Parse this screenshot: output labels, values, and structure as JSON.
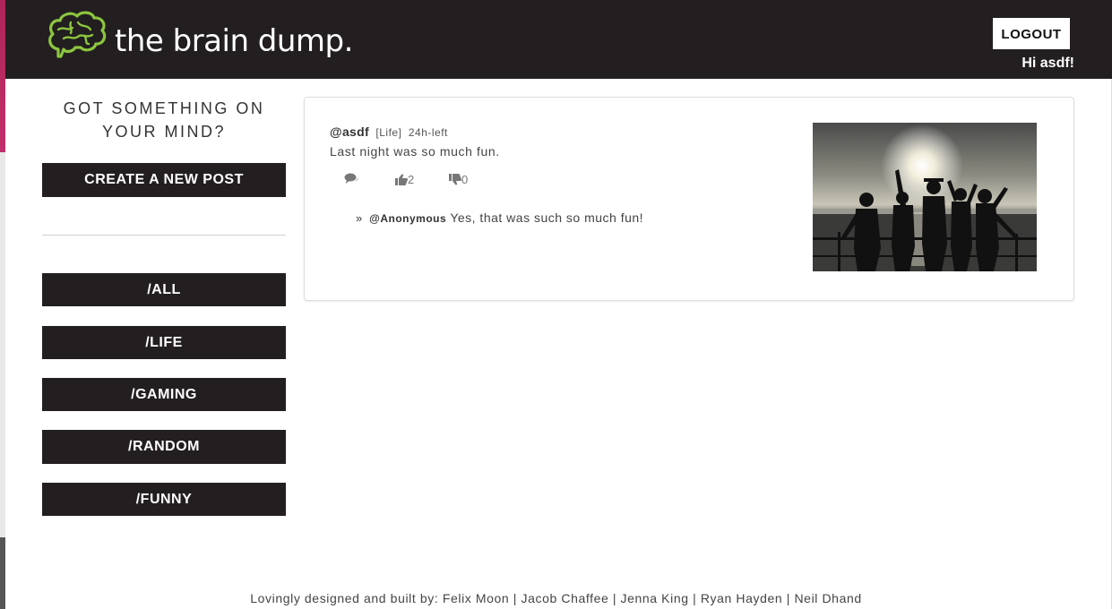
{
  "header": {
    "logo_text": "the brain dump.",
    "logout_label": "LOGOUT",
    "greeting": "Hi asdf!"
  },
  "sidebar": {
    "prompt_line1": "GOT SOMETHING ON",
    "prompt_line2": "YOUR MIND?",
    "create_post_label": "CREATE A NEW POST",
    "categories": [
      "/ALL",
      "/LIFE",
      "/GAMING",
      "/RANDOM",
      "/FUNNY"
    ]
  },
  "post": {
    "user": "@asdf",
    "category": "[Life]",
    "time_left": "24h-left",
    "body": "Last night was so much fun.",
    "likes": "2",
    "dislikes": "0",
    "comments": [
      {
        "user": "@Anonymous",
        "text": "Yes, that was such so much fun!"
      }
    ]
  },
  "footer": {
    "credits": "Lovingly designed and built by: Felix Moon | Jacob Chaffee | Jenna King | Ryan Hayden | Neil Dhand"
  },
  "colors": {
    "header_bg": "#231f20",
    "button_bg": "#231f20",
    "logo_green": "#8cc63f"
  },
  "icons": [
    "brain-logo-icon",
    "comment-icon",
    "thumbs-up-icon",
    "thumbs-down-icon",
    "double-chevron-icon"
  ]
}
